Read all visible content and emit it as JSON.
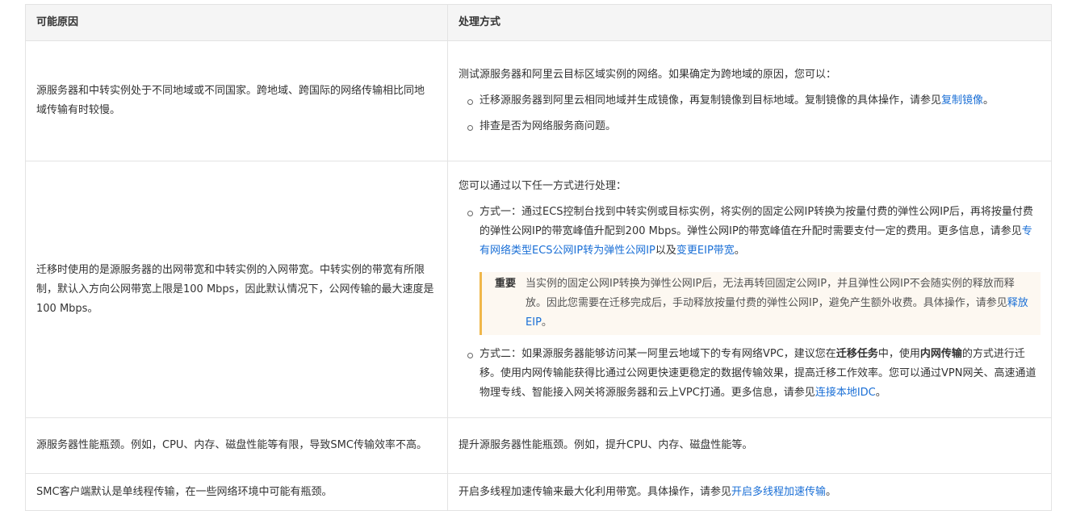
{
  "headers": {
    "cause": "可能原因",
    "solution": "处理方式"
  },
  "rows": [
    {
      "cause": "源服务器和中转实例处于不同地域或不同国家。跨地域、跨国际的网络传输相比同地域传输有时较慢。",
      "intro": "测试源服务器和阿里云目标区域实例的网络。如果确定为跨地域的原因，您可以：",
      "item1_text": "迁移源服务器到阿里云相同地域并生成镜像，再复制镜像到目标地域。复制镜像的具体操作，请参见",
      "item1_link": "复制镜像",
      "item1_end": "。",
      "item2_text": "排查是否为网络服务商问题。"
    },
    {
      "cause": "迁移时使用的是源服务器的出网带宽和中转实例的入网带宽。中转实例的带宽有所限制，默认入方向公网带宽上限是100 Mbps，因此默认情况下，公网传输的最大速度是100 Mbps。",
      "intro": "您可以通过以下任一方式进行处理：",
      "item1_text": "方式一：通过ECS控制台找到中转实例或目标实例，将实例的固定公网IP转换为按量付费的弹性公网IP后，再将按量付费的弹性公网IP的带宽峰值升配到200 Mbps。弹性公网IP的带宽峰值在升配时需要支付一定的费用。更多信息，请参见",
      "item1_link1": "专有网络类型ECS公网IP转为弹性公网IP",
      "item1_mid": "以及",
      "item1_link2": "变更EIP带宽",
      "item1_end": "。",
      "note_title": "重要",
      "note_text": "当实例的固定公网IP转换为弹性公网IP后，无法再转回固定公网IP，并且弹性公网IP不会随实例的释放而释放。因此您需要在迁移完成后，手动释放按量付费的弹性公网IP，避免产生额外收费。具体操作，请参见",
      "note_link": "释放EIP",
      "note_end": "。",
      "item2_a": "方式二：如果源服务器能够访问某一阿里云地域下的专有网络VPC，建议您在",
      "item2_b1": "迁移任务",
      "item2_b": "中，使用",
      "item2_b2": "内网传输",
      "item2_c": "的方式进行迁移。使用内网传输能获得比通过公网更快速更稳定的数据传输效果，提高迁移工作效率。您可以通过VPN网关、高速通道物理专线、智能接入网关将源服务器和云上VPC打通。更多信息，请参见",
      "item2_link": "连接本地IDC",
      "item2_end": "。"
    },
    {
      "cause": "源服务器性能瓶颈。例如，CPU、内存、磁盘性能等有限，导致SMC传输效率不高。",
      "solution": "提升源服务器性能瓶颈。例如，提升CPU、内存、磁盘性能等。"
    },
    {
      "cause": "SMC客户端默认是单线程传输，在一些网络环境中可能有瓶颈。",
      "solution_text": "开启多线程加速传输来最大化利用带宽。具体操作，请参见",
      "solution_link": "开启多线程加速传输",
      "solution_end": "。"
    }
  ]
}
